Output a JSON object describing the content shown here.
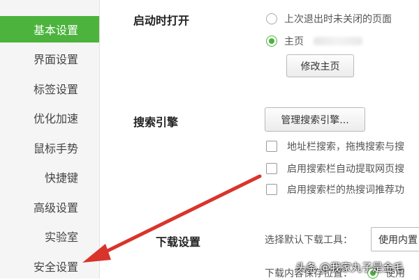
{
  "sidebar": {
    "items": [
      {
        "label": "基本设置",
        "active": true
      },
      {
        "label": "界面设置"
      },
      {
        "label": "标签设置"
      },
      {
        "label": "优化加速"
      },
      {
        "label": "鼠标手势"
      },
      {
        "label": "快捷键"
      },
      {
        "label": "高级设置"
      },
      {
        "label": "实验室"
      },
      {
        "label": "安全设置"
      }
    ]
  },
  "startup": {
    "title": "启动时打开",
    "option_restore": "上次退出时未关闭的页面",
    "option_home": "主页",
    "change_home_button": "修改主页"
  },
  "search": {
    "title": "搜索引擎",
    "manage_button": "管理搜索引擎...",
    "opt1": "地址栏搜索，拖拽搜索与搜",
    "opt2": "启用搜索栏自动提取网页搜",
    "opt3": "启用搜索栏的热搜词推荐功"
  },
  "download": {
    "title": "下载设置",
    "select_label": "选择默认下载工具：",
    "select_value": "使用内置",
    "save_location_label": "下载内容保存位置：",
    "save_location_option": "使用"
  },
  "watermark": "头条 @我家丸子是金毛",
  "colors": {
    "accent": "#4cb33d",
    "arrow": "#d9342b"
  }
}
